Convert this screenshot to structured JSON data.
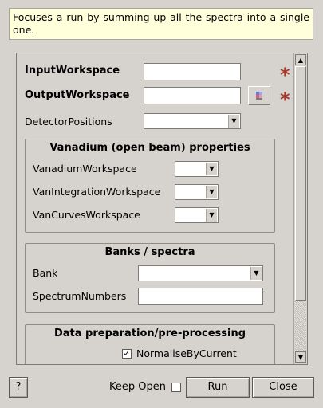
{
  "description": "Focuses a run by summing up all the spectra into a single one.",
  "fields": {
    "input_workspace": {
      "label": "InputWorkspace",
      "value": ""
    },
    "output_workspace": {
      "label": "OutputWorkspace",
      "value": ""
    },
    "detector_positions": {
      "label": "DetectorPositions",
      "value": ""
    }
  },
  "groups": {
    "vanadium": {
      "title": "Vanadium (open beam) properties",
      "van_workspace": {
        "label": "VanadiumWorkspace",
        "value": ""
      },
      "van_integration": {
        "label": "VanIntegrationWorkspace",
        "value": ""
      },
      "van_curves": {
        "label": "VanCurvesWorkspace",
        "value": ""
      }
    },
    "banks": {
      "title": "Banks / spectra",
      "bank": {
        "label": "Bank",
        "value": ""
      },
      "spectrum_numbers": {
        "label": "SpectrumNumbers",
        "value": ""
      }
    },
    "prep": {
      "title": "Data preparation/pre-processing",
      "normalise_by_current": {
        "label": "NormaliseByCurrent",
        "checked": true,
        "mark": "✓"
      }
    }
  },
  "footer": {
    "help_label": "?",
    "keep_open_label": "Keep Open",
    "run_label": "Run",
    "close_label": "Close"
  },
  "colors": {
    "required_star": "#a53a2a",
    "description_bg": "#ffffdc",
    "window_bg": "#d6d3ce"
  }
}
